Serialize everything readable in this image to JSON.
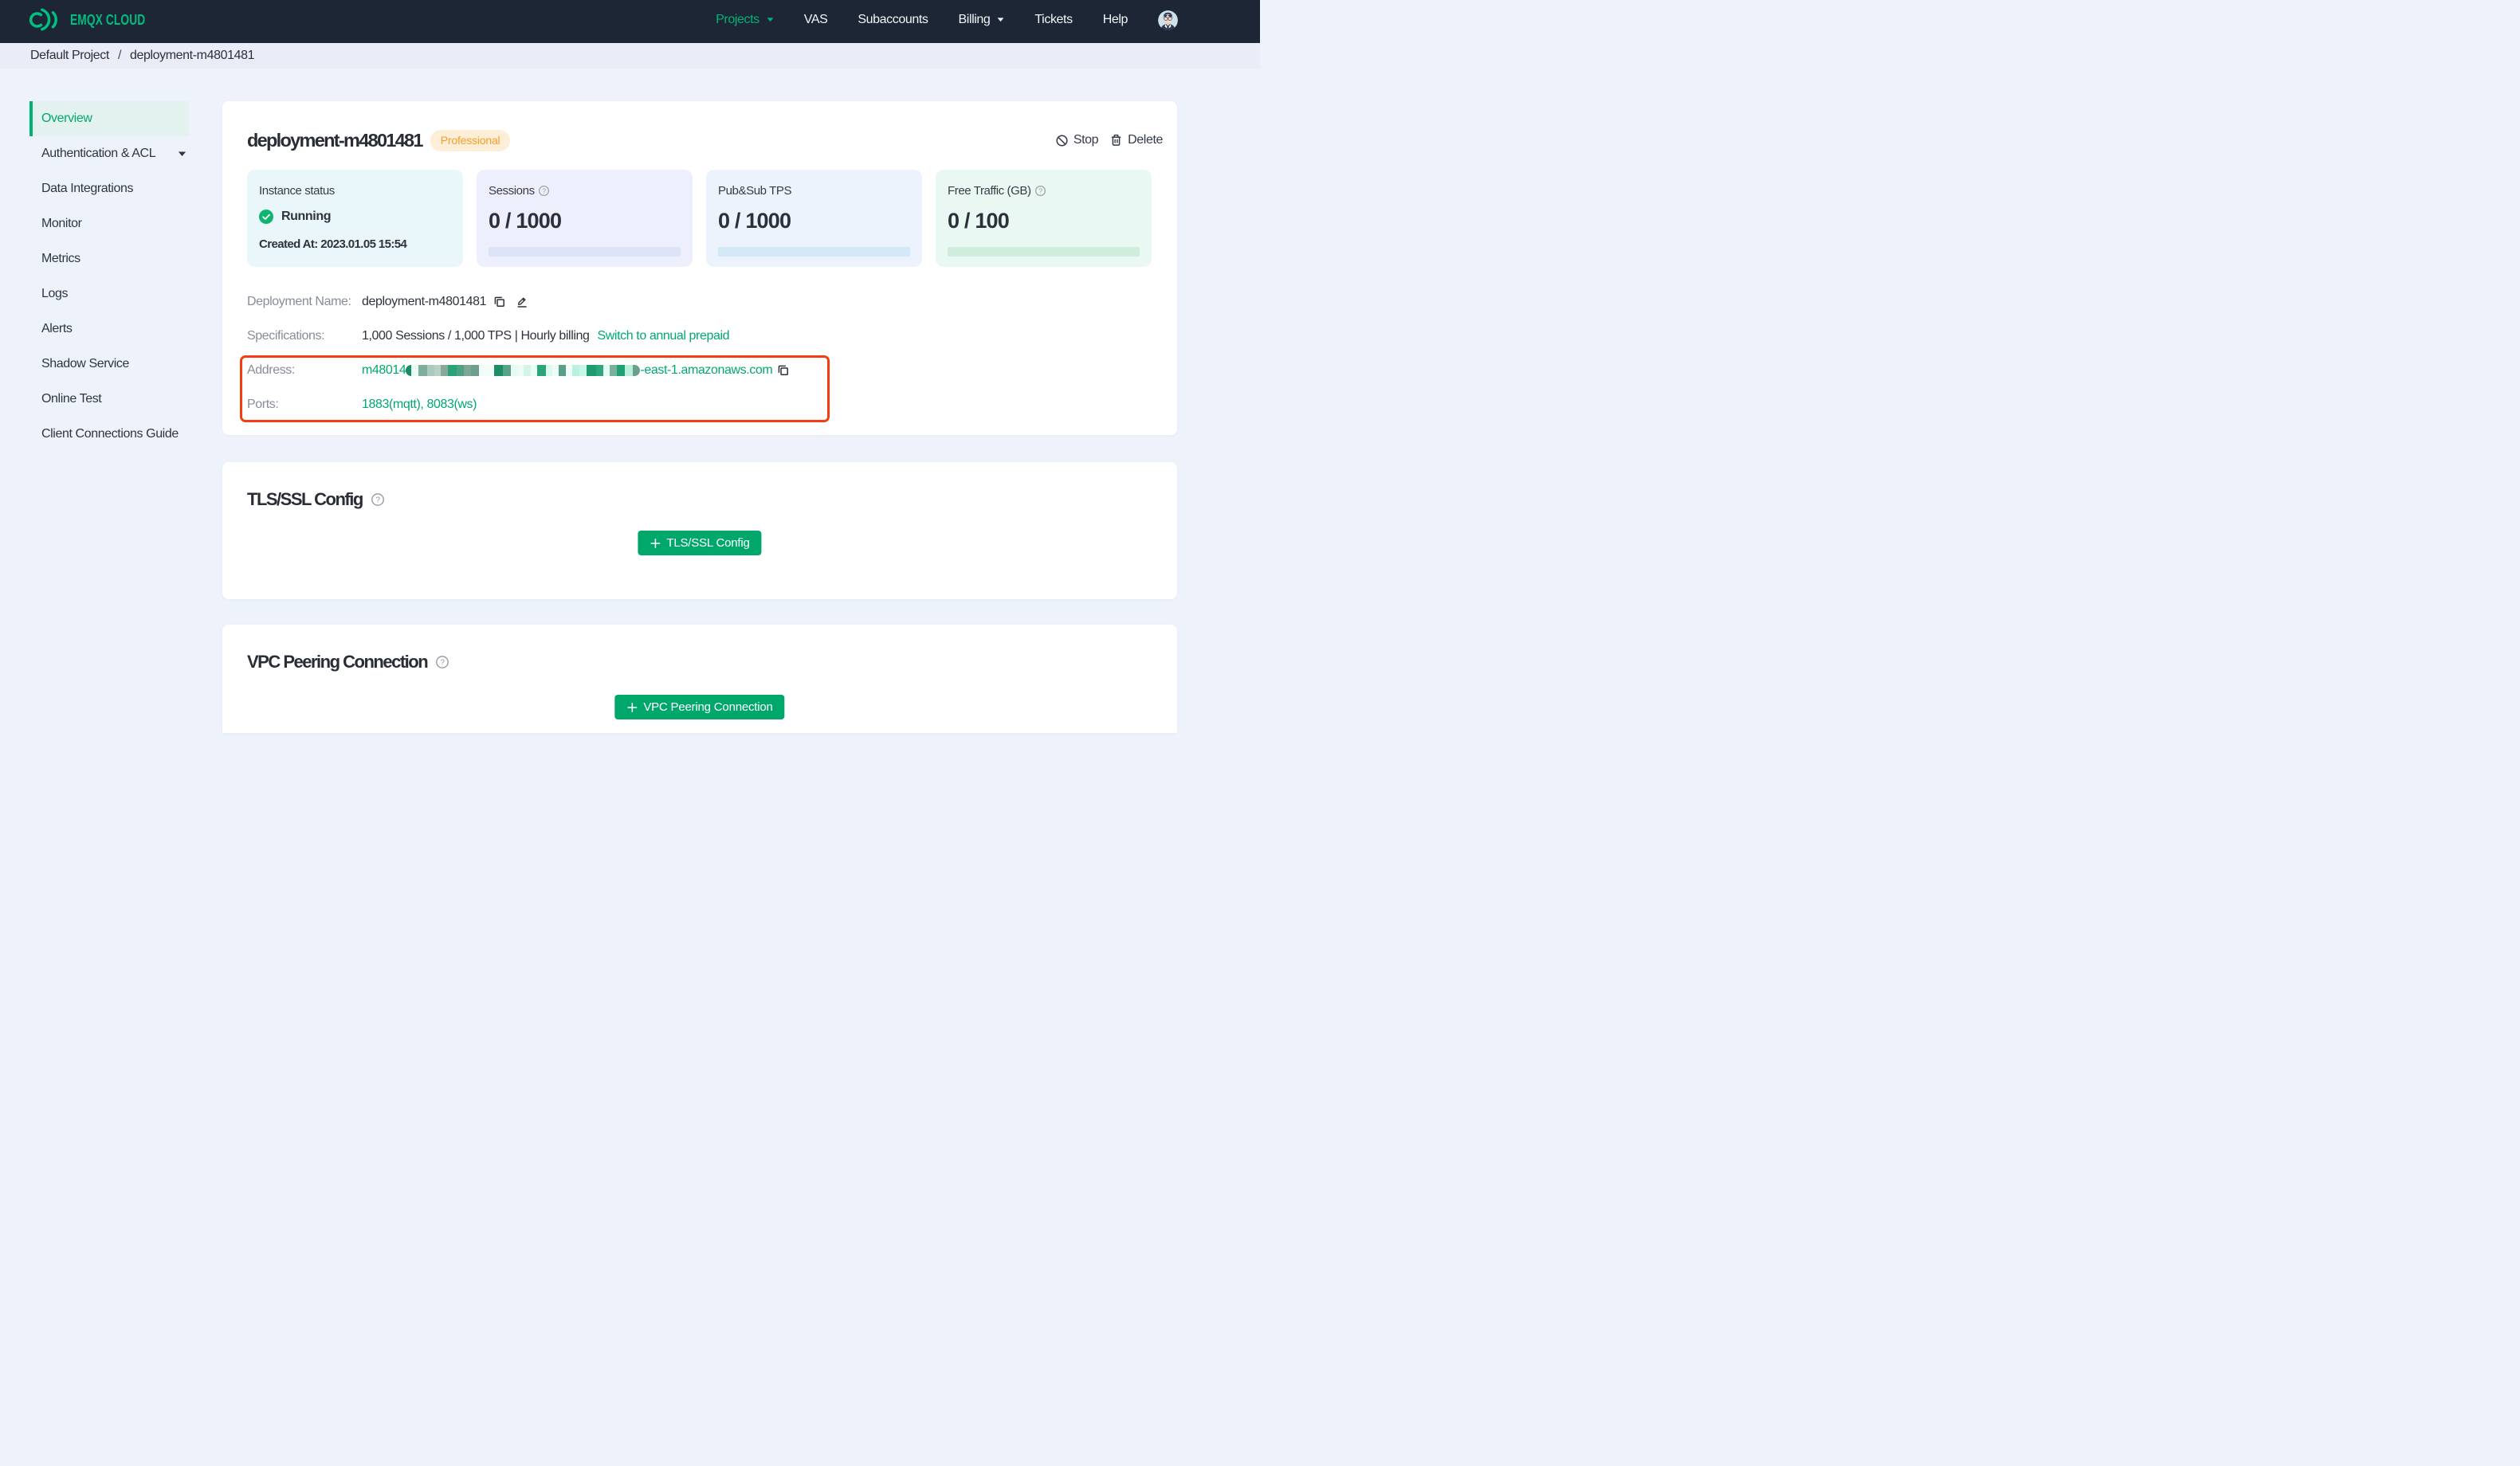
{
  "brand": {
    "name": "EMQX CLOUD"
  },
  "nav": {
    "items": [
      {
        "label": "Projects",
        "active": true,
        "caret": true
      },
      {
        "label": "VAS"
      },
      {
        "label": "Subaccounts"
      },
      {
        "label": "Billing",
        "caret": true
      },
      {
        "label": "Tickets"
      },
      {
        "label": "Help"
      }
    ]
  },
  "breadcrumb": {
    "project": "Default Project",
    "separator": "/",
    "current": "deployment-m4801481"
  },
  "sidebar": {
    "items": [
      {
        "label": "Overview",
        "active": true
      },
      {
        "label": "Authentication & ACL",
        "caret": true
      },
      {
        "label": "Data Integrations"
      },
      {
        "label": "Monitor"
      },
      {
        "label": "Metrics"
      },
      {
        "label": "Logs"
      },
      {
        "label": "Alerts"
      },
      {
        "label": "Shadow Service"
      },
      {
        "label": "Online Test"
      },
      {
        "label": "Client Connections Guide"
      }
    ]
  },
  "deployment": {
    "title": "deployment-m4801481",
    "badge": "Professional",
    "actions": {
      "stop": "Stop",
      "delete": "Delete"
    },
    "stats": [
      {
        "label": "Instance status",
        "status": "Running",
        "created": "Created At: 2023.01.05 15:54"
      },
      {
        "label": "Sessions",
        "value": "0 / 1000",
        "help": true
      },
      {
        "label": "Pub&Sub TPS",
        "value": "0 / 1000"
      },
      {
        "label": "Free Traffic (GB)",
        "value": "0 / 100",
        "help": true
      }
    ],
    "info": {
      "name_label": "Deployment Name:",
      "name_value": "deployment-m4801481",
      "spec_label": "Specifications:",
      "spec_value": "1,000 Sessions / 1,000 TPS | Hourly billing",
      "spec_link": "Switch to annual prepaid",
      "address_label": "Address:",
      "address_prefix": "m48014",
      "address_suffix": "-east-1.amazonaws.com",
      "ports_label": "Ports:",
      "ports_value": "1883(mqtt), 8083(ws)"
    },
    "censor_blocks": [
      {
        "c": "#1b8a66",
        "w": 7
      },
      {
        "c": "#e8fbf5",
        "w": 9
      },
      {
        "c": "#7fae9d",
        "w": 11
      },
      {
        "c": "#a9cabd",
        "w": 9
      },
      {
        "c": "#bccfc6",
        "w": 8
      },
      {
        "c": "#8aa89a",
        "w": 9
      },
      {
        "c": "#27a377",
        "w": 11
      },
      {
        "c": "#4ca183",
        "w": 9
      },
      {
        "c": "#7da694",
        "w": 9
      },
      {
        "c": "#6c9f8d",
        "w": 10
      },
      {
        "c": "#f4fcf9",
        "w": 10
      },
      {
        "c": "#f3fdf9",
        "w": 9
      },
      {
        "c": "#1d8e66",
        "w": 11
      },
      {
        "c": "#55a489",
        "w": 10
      },
      {
        "c": "#e6fbf4",
        "w": 9
      },
      {
        "c": "#eefbf6",
        "w": 7
      },
      {
        "c": "#d4f4e8",
        "w": 9
      },
      {
        "c": "#eafdf8",
        "w": 8
      },
      {
        "c": "#2aa478",
        "w": 11
      },
      {
        "c": "#dcf9f2",
        "w": 8
      },
      {
        "c": "#f0fcf8",
        "w": 8
      },
      {
        "c": "#589f87",
        "w": 9
      },
      {
        "c": "#f0fcf8",
        "w": 8
      },
      {
        "c": "#baf0de",
        "w": 9
      },
      {
        "c": "#c8f7e9",
        "w": 9
      },
      {
        "c": "#1e9c70",
        "w": 12
      },
      {
        "c": "#31a57c",
        "w": 9
      },
      {
        "c": "#e3fcf6",
        "w": 8
      },
      {
        "c": "#79b09f",
        "w": 9
      },
      {
        "c": "#21a173",
        "w": 10
      },
      {
        "c": "#b9eeda",
        "w": 10
      },
      {
        "c": "#68a18f",
        "w": 9
      }
    ]
  },
  "sections": [
    {
      "title": "TLS/SSL Config",
      "button": "TLS/SSL Config"
    },
    {
      "title": "VPC Peering Connection",
      "button": "VPC Peering Connection"
    }
  ],
  "colors": {
    "navbar_bg": "#1d2634",
    "brand_green": "#00bd7e",
    "accent_green": "#00a96e",
    "button_green": "#00a76a",
    "annotation_red": "#f53b10",
    "badge_bg": "#fdeed8",
    "badge_text": "#f79e27",
    "page_bg": "#eef3fb",
    "breadcrumb_bg": "#e8edf7"
  }
}
